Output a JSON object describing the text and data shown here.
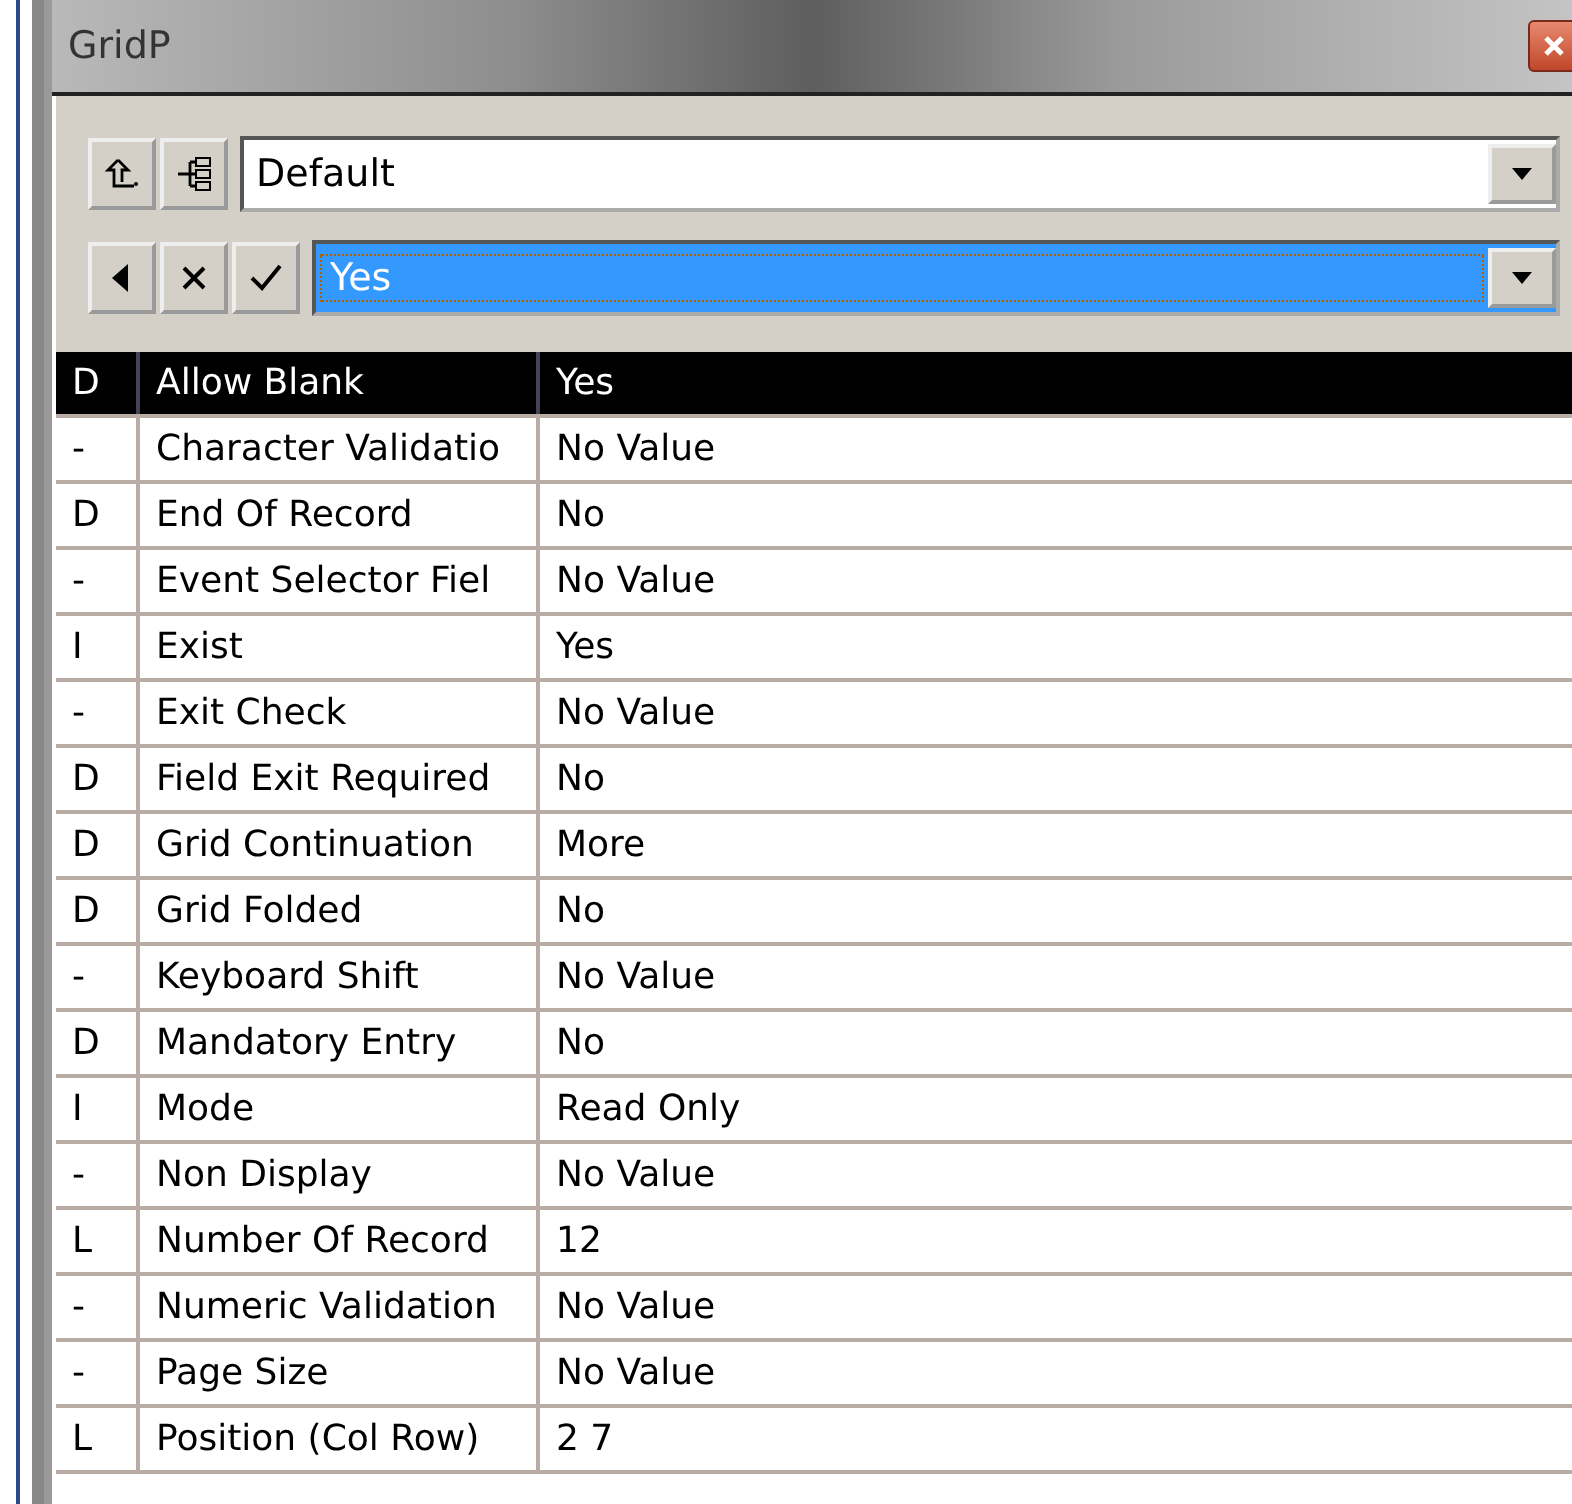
{
  "window": {
    "title": "GridP"
  },
  "toolbar": {
    "context_combo": {
      "value": "Default"
    },
    "value_combo": {
      "value": "Yes",
      "selected": true
    }
  },
  "properties": [
    {
      "flag": "D",
      "name": "Allow Blank",
      "value": "Yes",
      "selected": true
    },
    {
      "flag": "-",
      "name": "Character Validatio",
      "value": "No Value",
      "selected": false
    },
    {
      "flag": "D",
      "name": "End Of Record",
      "value": "No",
      "selected": false
    },
    {
      "flag": "-",
      "name": "Event Selector Fiel",
      "value": "No Value",
      "selected": false
    },
    {
      "flag": "I",
      "name": "Exist",
      "value": "Yes",
      "selected": false
    },
    {
      "flag": "-",
      "name": "Exit Check",
      "value": "No Value",
      "selected": false
    },
    {
      "flag": "D",
      "name": "Field Exit Required",
      "value": "No",
      "selected": false
    },
    {
      "flag": "D",
      "name": "Grid Continuation",
      "value": "More",
      "selected": false
    },
    {
      "flag": "D",
      "name": "Grid Folded",
      "value": "No",
      "selected": false
    },
    {
      "flag": "-",
      "name": "Keyboard Shift",
      "value": "No Value",
      "selected": false
    },
    {
      "flag": "D",
      "name": "Mandatory Entry",
      "value": "No",
      "selected": false
    },
    {
      "flag": "I",
      "name": "Mode",
      "value": "Read Only",
      "selected": false
    },
    {
      "flag": "-",
      "name": "Non Display",
      "value": "No Value",
      "selected": false
    },
    {
      "flag": "L",
      "name": "Number Of Record",
      "value": "12",
      "selected": false
    },
    {
      "flag": "-",
      "name": "Numeric Validation",
      "value": "No Value",
      "selected": false
    },
    {
      "flag": "-",
      "name": "Page Size",
      "value": "No Value",
      "selected": false
    },
    {
      "flag": "L",
      "name": "Position (Col Row)",
      "value": "2 7",
      "selected": false
    }
  ]
}
